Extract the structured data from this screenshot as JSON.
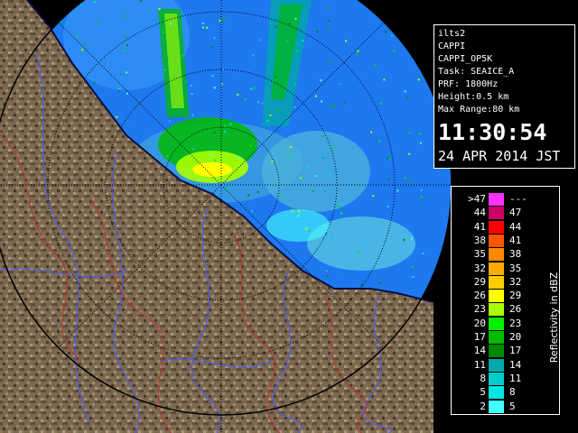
{
  "station": {
    "name": "ilts2",
    "product": "CAPPI",
    "product_code": "CAPPI_OP5K",
    "task": "Task: SEAICE_A",
    "prf": "PRF: 1800Hz",
    "height": "Height:0.5 km",
    "max_range": "Max Range:80 km"
  },
  "time": "11:30:54",
  "date": "24 APR 2014 JST",
  "legend": {
    "title": "Reflectivity in dBZ",
    "rows": [
      {
        "low": ">47",
        "high": "---",
        "color": "#ff33ff"
      },
      {
        "low": "44",
        "high": "47",
        "color": "#cc0066"
      },
      {
        "low": "41",
        "high": "44",
        "color": "#ff0000"
      },
      {
        "low": "38",
        "high": "41",
        "color": "#ff5500"
      },
      {
        "low": "35",
        "high": "38",
        "color": "#ff8800"
      },
      {
        "low": "32",
        "high": "35",
        "color": "#ffaa00"
      },
      {
        "low": "29",
        "high": "32",
        "color": "#ffcc00"
      },
      {
        "low": "26",
        "high": "29",
        "color": "#ffff00"
      },
      {
        "low": "23",
        "high": "26",
        "color": "#aaff00"
      },
      {
        "low": "20",
        "high": "23",
        "color": "#00ee00"
      },
      {
        "low": "17",
        "high": "20",
        "color": "#00bb00"
      },
      {
        "low": "14",
        "high": "17",
        "color": "#008800"
      },
      {
        "low": "11",
        "high": "14",
        "color": "#00aaaa"
      },
      {
        "low": "8",
        "high": "11",
        "color": "#00cccc"
      },
      {
        "low": "5",
        "high": "8",
        "color": "#00e5e5"
      },
      {
        "low": "2",
        "high": "5",
        "color": "#44ffff"
      }
    ]
  },
  "colors": {
    "echo_background": "#1e78f0",
    "land": "#7a6850",
    "coast": "#0a1040",
    "rivers": "#4a5aff",
    "boundaries": "#c03030",
    "range_rings": "#000000"
  }
}
